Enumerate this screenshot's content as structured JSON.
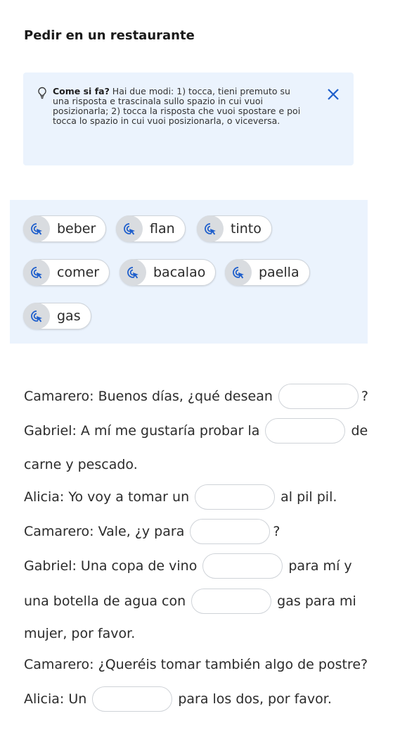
{
  "title": "Pedir en un restaurante",
  "hint": {
    "bold": "Come si fa?",
    "text": " Hai due modi: 1) tocca, tieni premuto su una risposta e trascinala sullo spazio in cui vuoi posizionarla; 2) tocca la risposta che vuoi spostare e poi tocca lo spazio in cui vuoi posizionarla, o viceversa."
  },
  "word_bank": [
    "beber",
    "flan",
    "tinto",
    "comer",
    "bacalao",
    "paella",
    "gas"
  ],
  "dialog": [
    {
      "pre": "Camarero: Buenos días, ¿qué desean",
      "post": "?"
    },
    {
      "pre": "Gabriel: A mí me gustaría probar la",
      "post": "de"
    },
    {
      "pre": "carne y pescado."
    },
    {
      "pre": "Alicia: Yo voy a tomar un",
      "post": "al pil pil."
    },
    {
      "pre": "Camarero: Vale, ¿y para",
      "post": "?"
    },
    {
      "pre": "Gabriel: Una copa de vino",
      "post": "para mí y"
    },
    {
      "pre": "una botella de agua con",
      "post": "gas para mi"
    },
    {
      "pre": "mujer, por favor."
    },
    {
      "pre": "Camarero: ¿Queréis tomar también algo de postre?"
    },
    {
      "pre": "Alicia: Un",
      "post": "para los dos, por favor."
    }
  ],
  "colors": {
    "panel": "#ebf3fd",
    "accent": "#1f5fcc",
    "chip_icon_bg": "#d9dce0"
  }
}
